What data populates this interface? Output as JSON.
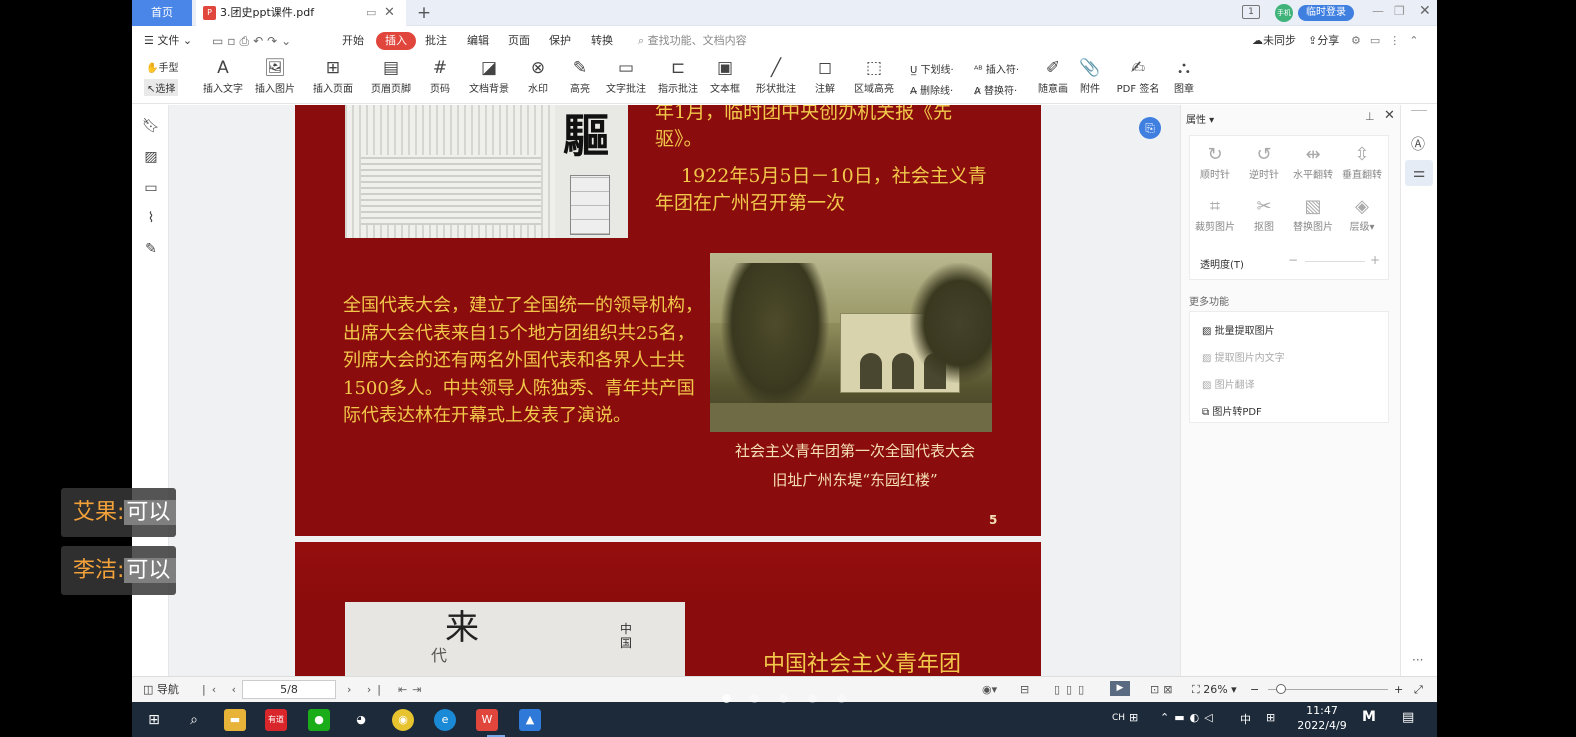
{
  "titlebar": {
    "home_tab": "首页",
    "doc_tab": "3.团史ppt课件.pdf",
    "badge": "1",
    "avatar": "手机",
    "login": "临时登录"
  },
  "menu": {
    "file": "文件",
    "items": [
      "开始",
      "插入",
      "批注",
      "编辑",
      "页面",
      "保护",
      "转换"
    ],
    "search_placeholder": "查找功能、文档内容",
    "sync": "未同步",
    "share": "分享"
  },
  "toolbar": {
    "hand": "手型",
    "select": "选择",
    "tools": [
      "插入文字",
      "插入图片",
      "插入页面",
      "页眉页脚",
      "页码",
      "文档背景",
      "水印",
      "高亮",
      "文字批注",
      "指示批注",
      "文本框",
      "形状批注",
      "注解",
      "区域高亮"
    ],
    "small_tools": [
      "下划线",
      "插入符",
      "删除线",
      "替换符"
    ],
    "tools_right": [
      "随意画",
      "附件",
      "PDF 签名",
      "图章"
    ]
  },
  "document": {
    "p5_top_text": "年1月，临时团中央创办机关报《先驱》。",
    "p5_para1": "1922年5月5日－10日，社会主义青年团在广州召开第一次",
    "p5_para2": "全国代表大会，建立了全国统一的领导机构，出席大会代表来自15个地方团组织共25名，列席大会的还有两名外国代表和各界人士共1500多人。中共领导人陈独秀、青年共产国际代表达林在开幕式上发表了演说。",
    "p5_caption1": "社会主义青年团第一次全国代表大会",
    "p5_caption2": "旧址广州东堤“东园红楼”",
    "p5_pagenum": "5",
    "news_char": "驅",
    "p6_heading": "中国社会主义青年团"
  },
  "panel": {
    "title": "属性",
    "buttons1": [
      "顺时针",
      "逆时针",
      "水平翻转",
      "垂直翻转"
    ],
    "buttons2": [
      "裁剪图片",
      "抠图",
      "替换图片",
      "层级"
    ],
    "opacity": "透明度(T)",
    "more": "更多功能",
    "features": [
      "批量提取图片",
      "提取图片内文字",
      "图片翻译",
      "图片转PDF"
    ]
  },
  "status": {
    "nav": "导航",
    "page": "5/8",
    "zoom": "26%"
  },
  "taskbar": {
    "ime1": "CH",
    "ime2": "中",
    "time": "11:47",
    "date": "2022/4/9"
  },
  "chat": [
    {
      "name": "艾果:",
      "message": "可以"
    },
    {
      "name": "李洁:",
      "message": "可以"
    }
  ]
}
